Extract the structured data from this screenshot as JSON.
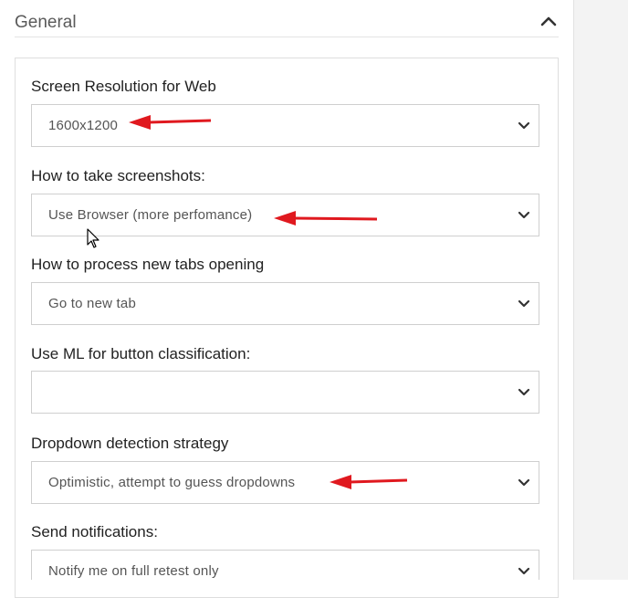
{
  "section": {
    "title": "General"
  },
  "fields": [
    {
      "label": "Screen Resolution for Web",
      "value": "1600x1200"
    },
    {
      "label": "How to take screenshots:",
      "value": "Use Browser (more perfomance)"
    },
    {
      "label": "How to process new tabs opening",
      "value": "Go to new tab"
    },
    {
      "label": "Use ML for button classification:",
      "value": ""
    },
    {
      "label": "Dropdown detection strategy",
      "value": "Optimistic, attempt to guess dropdowns"
    },
    {
      "label": "Send notifications:",
      "value": "Notify me on full retest only"
    }
  ],
  "colors": {
    "annotation_arrow": "#e0191f",
    "label_text": "#222222",
    "value_text": "#555555"
  },
  "icons": {
    "collapse": "chevron-up-icon",
    "select": "chevron-down-icon",
    "annotation": "red-arrow-icon",
    "cursor": "mouse-pointer-icon"
  }
}
